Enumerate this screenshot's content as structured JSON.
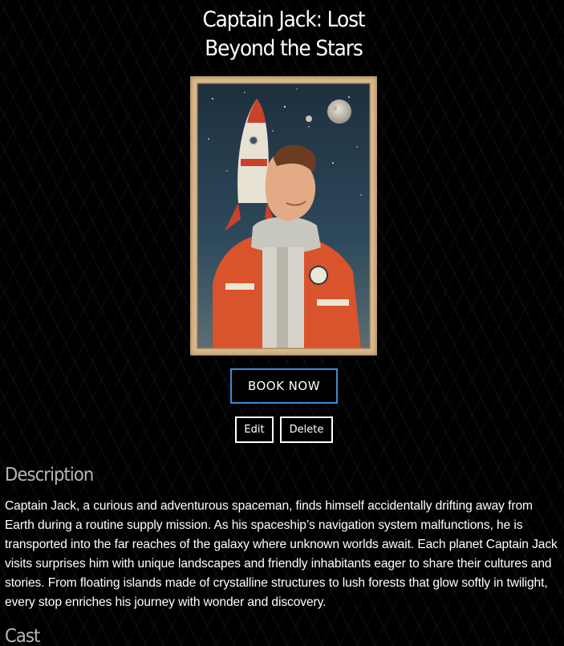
{
  "movie": {
    "title": "Captain Jack: Lost Beyond the Stars"
  },
  "actions": {
    "book_label": "BOOK NOW",
    "edit_label": "Edit",
    "delete_label": "Delete"
  },
  "description": {
    "heading": "Description",
    "text": "Captain Jack, a curious and adventurous spaceman, finds himself accidentally drifting away from Earth during a routine supply mission. As his spaceship’s navigation system malfunctions, he is transported into the far reaches of the galaxy where unknown worlds await. Each planet Captain Jack visits surprises him with unique landscapes and friendly inhabitants eager to share their cultures and stories. From floating islands made of crystalline structures to lush forests that glow softly in twilight, every stop enriches his journey with wonder and discovery."
  },
  "cast": {
    "heading": "Cast"
  },
  "colors": {
    "background": "#000000",
    "book_border": "#3f8ad6",
    "heading_gray": "#b7b7b7",
    "text": "#ffffff"
  }
}
